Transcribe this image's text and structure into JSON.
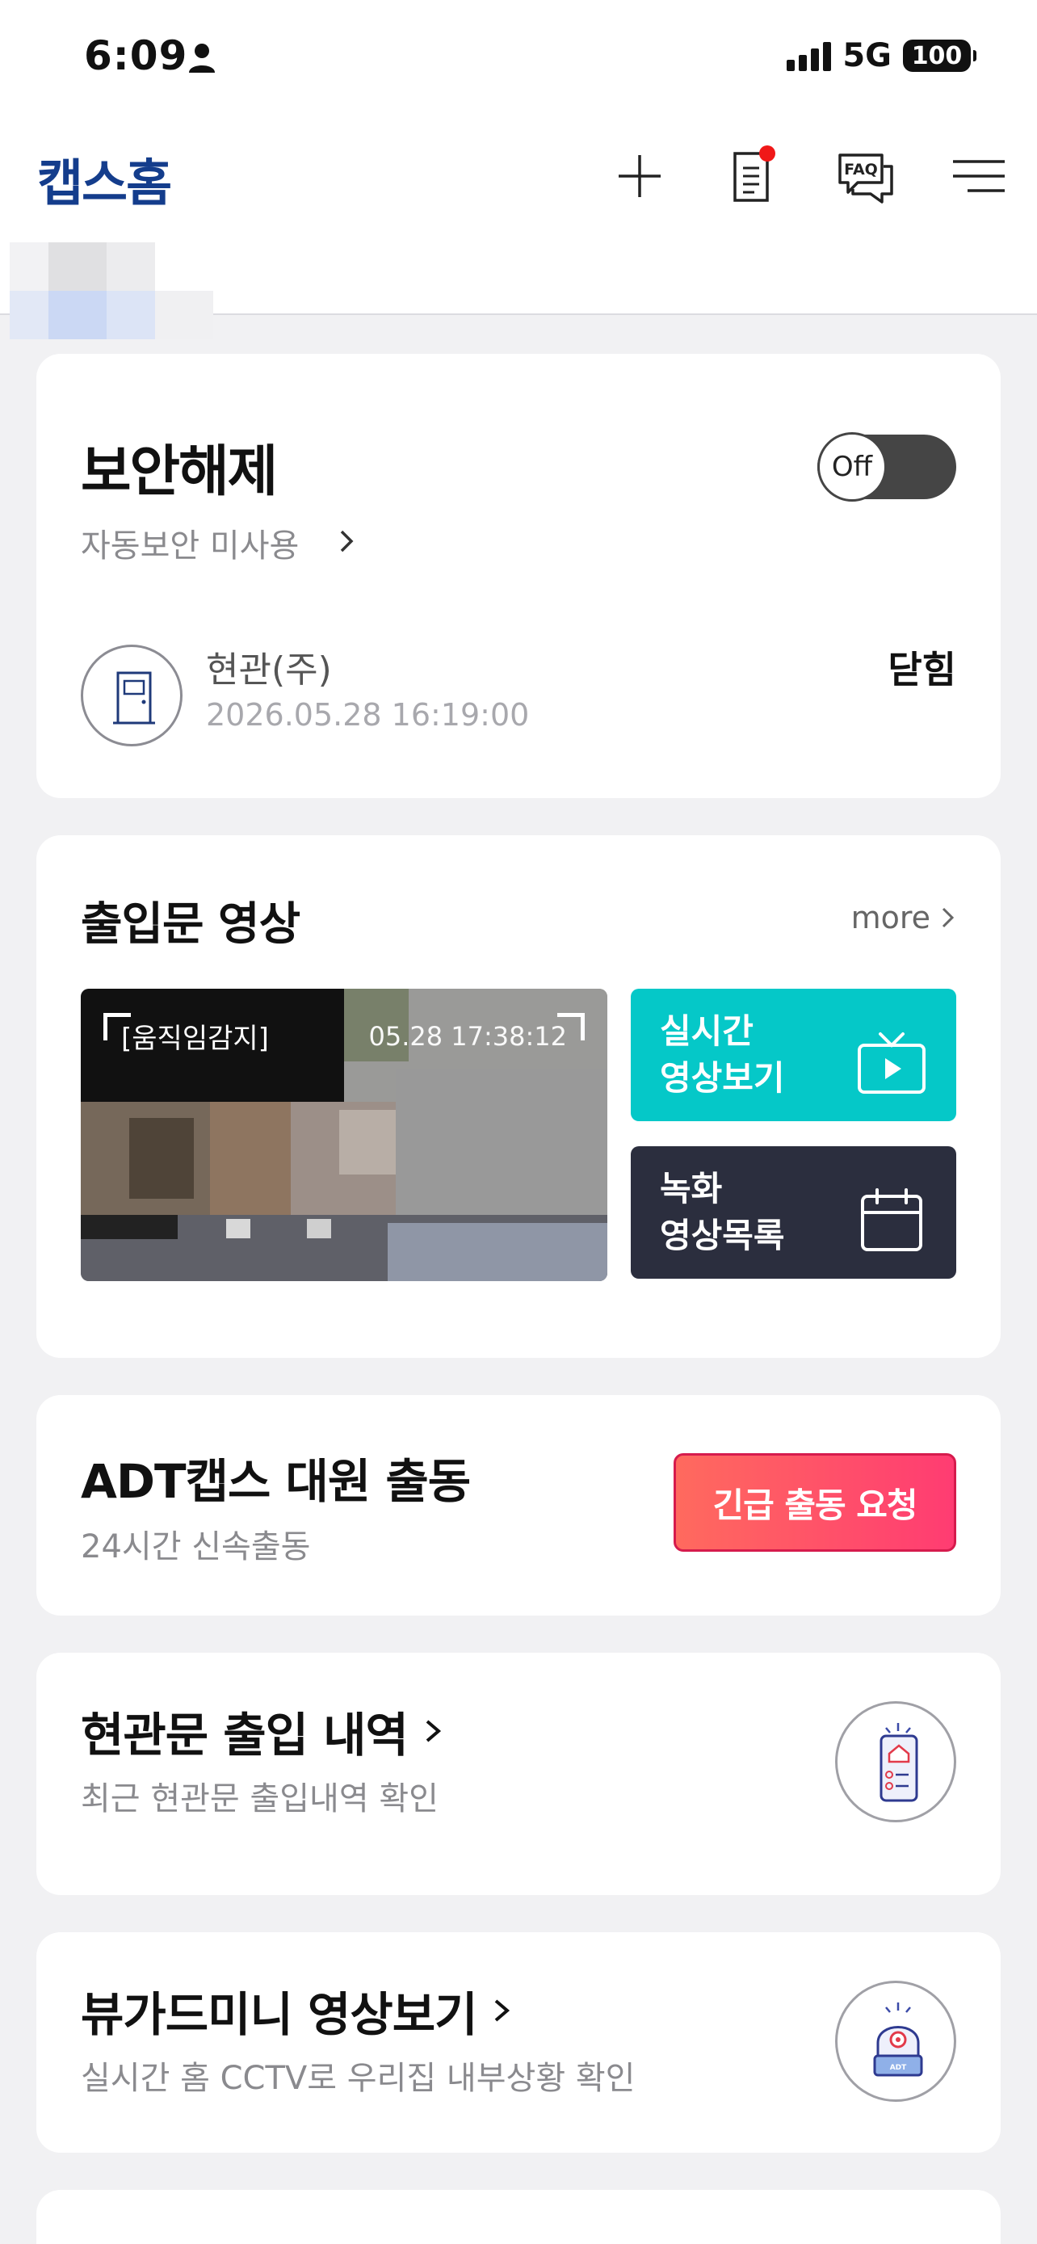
{
  "status_bar": {
    "time": "6:09",
    "network": "5G",
    "battery": "100"
  },
  "header": {
    "logo": "캡스홈"
  },
  "security": {
    "title": "보안해제",
    "auto_security": "자동보안 미사용",
    "toggle_label": "Off",
    "door": {
      "name": "현관(주)",
      "timestamp": "2026.05.28 16:19:00",
      "state": "닫힘"
    }
  },
  "video": {
    "title": "출입문 영상",
    "more": "more",
    "thumbnail": {
      "event": "[움직임감지]",
      "time": "05.28 17:38:12"
    },
    "live_button": {
      "line1": "실시간",
      "line2": "영상보기"
    },
    "record_button": {
      "line1": "녹화",
      "line2": "영상목록"
    },
    "colors": {
      "live": "#05c8c8",
      "record": "#2b2e3e"
    }
  },
  "dispatch": {
    "title": "ADT캡스 대원 출동",
    "subtitle": "24시간 신속출동",
    "button": "긴급 출동 요청",
    "button_color": "#ff4d6a"
  },
  "entry_history": {
    "title": "현관문 출입 내역",
    "subtitle": "최근 현관문 출입내역 확인"
  },
  "viewguard": {
    "title": "뷰가드미니 영상보기",
    "subtitle": "실시간 홈 CCTV로 우리집 내부상황 확인"
  }
}
